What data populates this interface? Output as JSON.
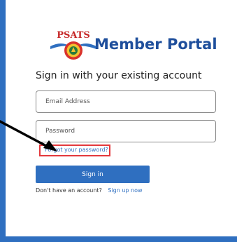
{
  "brand": {
    "logo_text": "PSATS",
    "title": "Member Portal"
  },
  "signin": {
    "heading": "Sign in with your existing account",
    "email_placeholder": "Email Address",
    "password_placeholder": "Password",
    "forgot_label": "Forgot your password?",
    "submit_label": "Sign in",
    "no_account_text": "Don't have an account?",
    "signup_label": "Sign up now"
  },
  "annotations": {
    "highlight_color": "#e4393d",
    "arrow_color": "#000000"
  },
  "colors": {
    "accent": "#2f6fc0",
    "brand_text": "#1f4f9c"
  }
}
